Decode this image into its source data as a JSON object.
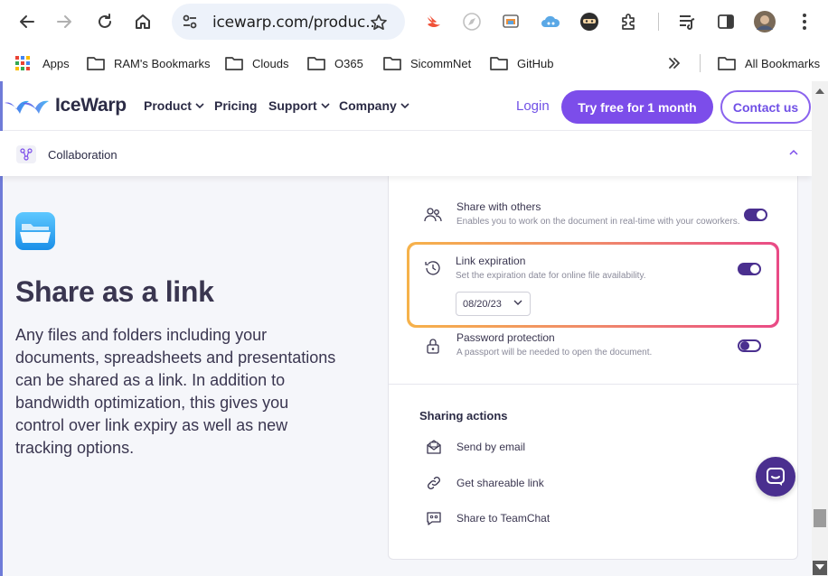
{
  "browser": {
    "url": "icewarp.com/produc...",
    "bookmarks": [
      {
        "label": "Apps",
        "icon": "apps-grid-icon"
      },
      {
        "label": "RAM's Bookmarks",
        "icon": "folder-icon"
      },
      {
        "label": "Clouds",
        "icon": "folder-icon"
      },
      {
        "label": "O365",
        "icon": "folder-icon"
      },
      {
        "label": "SicommNet",
        "icon": "folder-icon"
      },
      {
        "label": "GitHub",
        "icon": "folder-icon"
      }
    ],
    "all_bookmarks": "All Bookmarks"
  },
  "site": {
    "brand": "IceWarp",
    "nav": {
      "product": "Product",
      "pricing": "Pricing",
      "support": "Support",
      "company": "Company",
      "login": "Login",
      "try_free": "Try free for 1 month",
      "contact": "Contact us"
    },
    "subnav": {
      "label": "Collaboration"
    },
    "colors": {
      "accent": "#7c4dea",
      "dark_purple": "#4a2f8f",
      "text": "#3a3650"
    }
  },
  "hero": {
    "title": "Share as a link",
    "text": "Any files and folders including your documents, spreadsheets and presentations can be shared as a link. In addition to bandwidth optimization, this gives you control over link expiry as well as new tracking options."
  },
  "card": {
    "options": [
      {
        "title": "Share with others",
        "desc": "Enables you to work on the document in real-time with your coworkers.",
        "enabled": true
      },
      {
        "title": "Link expiration",
        "desc": "Set the expiration date for online file availability.",
        "enabled": true,
        "date": "08/20/23"
      },
      {
        "title": "Password protection",
        "desc": "A passport will be needed to open the document.",
        "enabled": false
      }
    ],
    "actions_title": "Sharing actions",
    "actions": [
      {
        "label": "Send by email",
        "icon": "email-icon"
      },
      {
        "label": "Get shareable link",
        "icon": "link-icon"
      },
      {
        "label": "Share to TeamChat",
        "icon": "teamchat-icon"
      }
    ]
  }
}
